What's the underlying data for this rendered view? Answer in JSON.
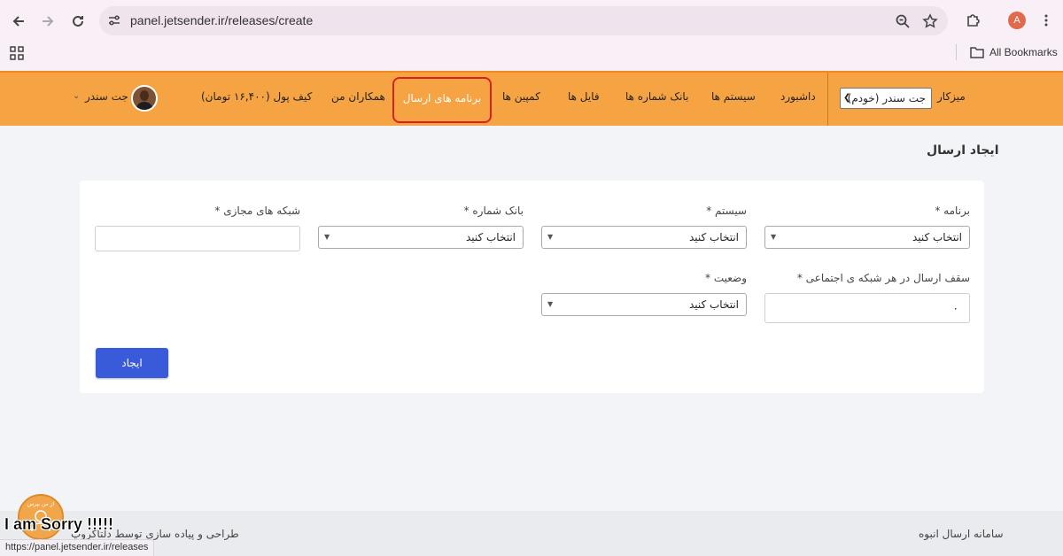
{
  "browser": {
    "url": "panel.jetsender.ir/releases/create",
    "bookmarks_label": "All Bookmarks",
    "profile_initial": "A",
    "status_url": "https://panel.jetsender.ir/releases"
  },
  "navbar": {
    "workspace_label": "میزکار",
    "workspace_value": "جت سندر (خودم)",
    "items": [
      "داشبورد",
      "سیستم ها",
      "بانک شماره ها",
      "فایل ها",
      "کمپین ها",
      "برنامه های ارسال",
      "همکاران من",
      "کیف پول (۱۶,۴۰۰ تومان)"
    ],
    "active_item": "برنامه های ارسال",
    "user_name": "جت سندر"
  },
  "page": {
    "title": "ایجاد ارسال"
  },
  "form": {
    "program_label": "برنامه *",
    "program_value": "انتخاب کنید",
    "system_label": "سیستم *",
    "system_value": "انتخاب کنید",
    "bank_label": "بانک شماره *",
    "bank_value": "انتخاب کنید",
    "virtual_label": "شبکه های مجازی *",
    "virtual_value": "",
    "cap_label": "سقف ارسال در هر شبکه ی اجتماعی *",
    "cap_value": "۰",
    "status_label": "وضعیت *",
    "status_value": "انتخاب کنید",
    "create_button": "ایجاد"
  },
  "footer": {
    "right_text": "سامانه ارسال انبوه",
    "left_text": "طراحی و پیاده سازی توسط دلتاگروپ"
  },
  "overlay": {
    "caption": "I am Sorry !!!!!",
    "sticker_text": "از من بپرس"
  },
  "colors": {
    "navbar": "#f6a443",
    "active_border": "#d62222",
    "primary_button": "#3a5bd9"
  }
}
